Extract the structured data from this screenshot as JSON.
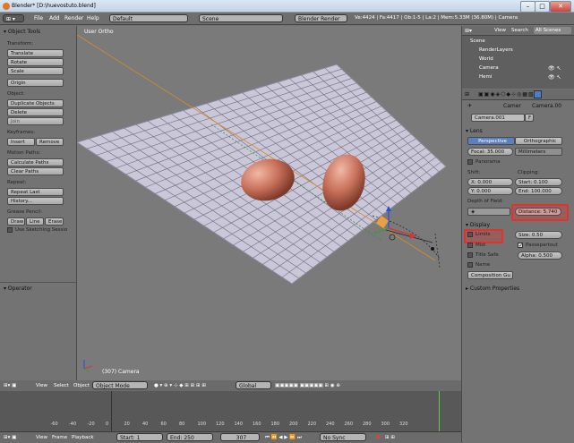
{
  "window": {
    "title": "Blender* [D:\\huevostuto.blend]",
    "btn_min": "–",
    "btn_max": "□",
    "btn_close": "✕"
  },
  "menu": {
    "file": "File",
    "add": "Add",
    "render": "Render",
    "help": "Help",
    "layout": "Default",
    "scene": "Scene",
    "engine": "Blender Render",
    "stats": "Ve:4424 | Fa:4417 | Ob:1-5 | La:2 | Mem:5.33M (36.80M) | Camera"
  },
  "tools": {
    "header": "▾ Object Tools",
    "transform_label": "Transform:",
    "translate": "Translate",
    "rotate": "Rotate",
    "scale": "Scale",
    "origin": "Origin",
    "object_label": "Object:",
    "duplicate": "Duplicate Objects",
    "delete": "Delete",
    "join": "Join",
    "keyframes_label": "Keyframes:",
    "insert": "Insert",
    "remove": "Remove",
    "motion_label": "Motion Paths:",
    "calc_paths": "Calculate Paths",
    "clear_paths": "Clear Paths",
    "repeat_label": "Repeat:",
    "repeat_last": "Repeat Last",
    "history": "History...",
    "grease_label": "Grease Pencil:",
    "draw": "Draw",
    "line": "Line",
    "erase": "Erase",
    "sketching": "Use Sketching Sessio",
    "operator": "▾ Operator"
  },
  "viewport": {
    "view_label": "User Ortho",
    "frame_label": "(307) Camera"
  },
  "outliner": {
    "view": "View",
    "search": "Search",
    "all_scenes": "All Scenes",
    "items": [
      "Scene",
      "RenderLayers",
      "World",
      "Camera",
      "Hemi"
    ]
  },
  "props": {
    "breadcrumb_obj": "Camer",
    "breadcrumb_data": "Camera.00",
    "datablock": "Camera.001",
    "f_label": "F",
    "lens_header": "▾ Lens",
    "perspective": "Perspective",
    "orthographic": "Orthographic",
    "focal": "Focal: 35.000",
    "units": "Millimeters",
    "panorama": "Panorama",
    "shift_label": "Shift:",
    "shift_x": "X: 0.000",
    "shift_y": "Y: 0.000",
    "clipping_label": "Clipping:",
    "clip_start": "Start: 0.100",
    "clip_end": "End: 100.000",
    "dof_label": "Depth of Field:",
    "distance": "Distance: 5.740",
    "display_header": "▾ Display",
    "limits": "Limits",
    "mist": "Mist",
    "title_safe": "Title Safe",
    "name": "Name",
    "size": "Size: 0.50",
    "passepartout": "Passepartout",
    "alpha": "Alpha: 0.500",
    "composition": "Composition Gu",
    "custom": "▸ Custom Properties"
  },
  "timeline": {
    "view": "View",
    "select": "Select",
    "object": "Object",
    "mode": "Object Mode",
    "orientation": "Global",
    "f_view": "View",
    "f_frame": "Frame",
    "f_playback": "Playback",
    "start": "Start: 1",
    "end": "End: 250",
    "current": "307",
    "sync": "No Sync",
    "ticks": [
      "-60",
      "-40",
      "-20",
      "0",
      "20",
      "40",
      "60",
      "80",
      "100",
      "120",
      "140",
      "160",
      "180",
      "200",
      "220",
      "240",
      "260",
      "280",
      "300",
      "320"
    ]
  }
}
